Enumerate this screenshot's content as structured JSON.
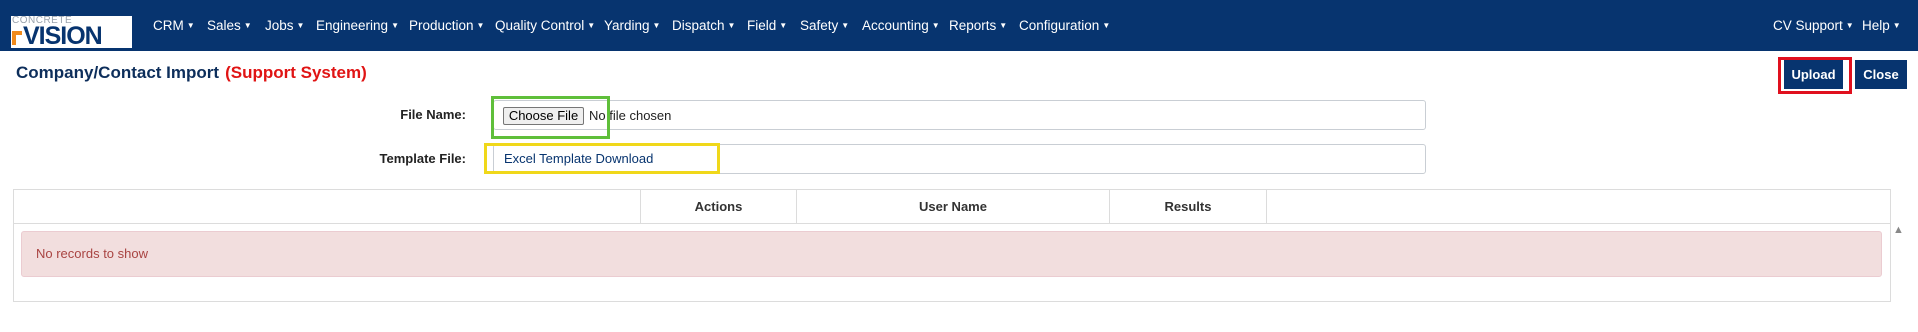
{
  "header": {
    "logo_top": "CONCRETE",
    "logo_main": "VISION",
    "menu": [
      {
        "label": "CRM"
      },
      {
        "label": "Sales"
      },
      {
        "label": "Jobs"
      },
      {
        "label": "Engineering"
      },
      {
        "label": "Production"
      },
      {
        "label": "Quality Control"
      },
      {
        "label": "Yarding"
      },
      {
        "label": "Dispatch"
      },
      {
        "label": "Field"
      },
      {
        "label": "Safety"
      },
      {
        "label": "Accounting"
      },
      {
        "label": "Reports"
      },
      {
        "label": "Configuration"
      }
    ],
    "right_menu": [
      {
        "label": "CV Support"
      },
      {
        "label": "Help"
      }
    ],
    "dropdown_icon": "caret-down-icon"
  },
  "page": {
    "title": "Company/Contact Import",
    "subtitle": "(Support System)"
  },
  "toolbar": {
    "upload_label": "Upload",
    "close_label": "Close"
  },
  "form": {
    "file_name_label": "File Name:",
    "choose_file_label": "Choose File",
    "no_file_text": "No file chosen",
    "template_file_label": "Template File:",
    "template_link": "Excel Template Download"
  },
  "grid": {
    "columns": [
      "",
      "Actions",
      "User Name",
      "Results",
      ""
    ],
    "empty_message": "No records to show"
  },
  "colors": {
    "navbar": "#07346f",
    "title": "#0d2e5b",
    "subtitle": "#e01414",
    "highlight_upload": "#e0101e",
    "highlight_choose": "#5fbf3a",
    "highlight_template": "#f0d81a",
    "empty_bg": "#f2dede",
    "empty_text": "#a94442"
  }
}
